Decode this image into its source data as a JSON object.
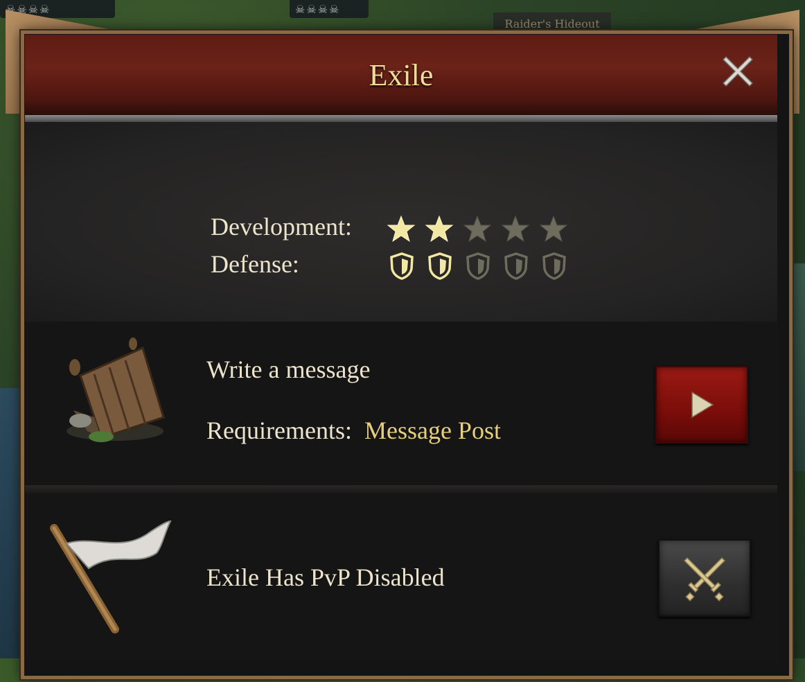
{
  "map": {
    "badge_left": "☠☠☠☠",
    "badge_center": "☠☠☠☠",
    "location_label": "Raider's Hideout"
  },
  "dialog": {
    "title": "Exile",
    "close_icon": "close-icon"
  },
  "stats": {
    "development_label": "Development:",
    "development_rating": 2,
    "development_max": 5,
    "defense_label": "Defense:",
    "defense_rating": 2,
    "defense_max": 5
  },
  "actions": [
    {
      "icon": "message-post-hut-icon",
      "title": "Write a message",
      "requirements_label": "Requirements:",
      "requirements_value": "Message Post",
      "button_icon": "play-arrow-icon"
    },
    {
      "icon": "white-flag-icon",
      "title": "Exile Has PvP Disabled",
      "button_icon": "crossed-swords-icon"
    }
  ],
  "colors": {
    "title_gold": "#f0dc9a",
    "requirement_gold": "#e8cf7e",
    "active_star": "#f3e7a4",
    "inactive_star": "#6e6c5c",
    "header_red": "#6b2218",
    "button_red": "#7a0d0a"
  }
}
